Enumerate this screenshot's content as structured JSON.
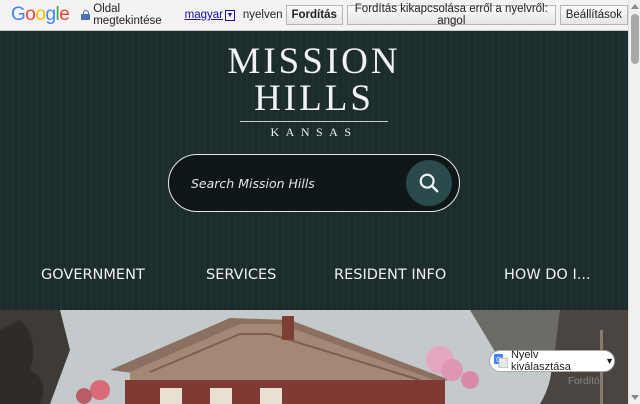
{
  "translate_bar": {
    "logo": "Google",
    "page_text": "Oldal megtekintése",
    "language": "magyar",
    "dropdown_symbol": "▼",
    "language_suffix": "nyelven",
    "translate_button": "Fordítás",
    "disable_button": "Fordítás kikapcsolása erről a nyelvről: angol",
    "settings_button": "Beállítások"
  },
  "logo": {
    "line1": "MISSION",
    "line2": "HILLS",
    "subtitle": "KANSAS"
  },
  "search": {
    "placeholder": "Search Mission Hills"
  },
  "nav": {
    "items": [
      {
        "label": "GOVERNMENT"
      },
      {
        "label": "SERVICES"
      },
      {
        "label": "RESIDENT INFO"
      },
      {
        "label": "HOW DO I..."
      }
    ]
  },
  "translate_widget": {
    "label": "Nyelv kiválasztása",
    "powered_by": "Fordító"
  },
  "colors": {
    "header_bg": "#1c2c2d",
    "search_btn": "#2a4a4c"
  }
}
